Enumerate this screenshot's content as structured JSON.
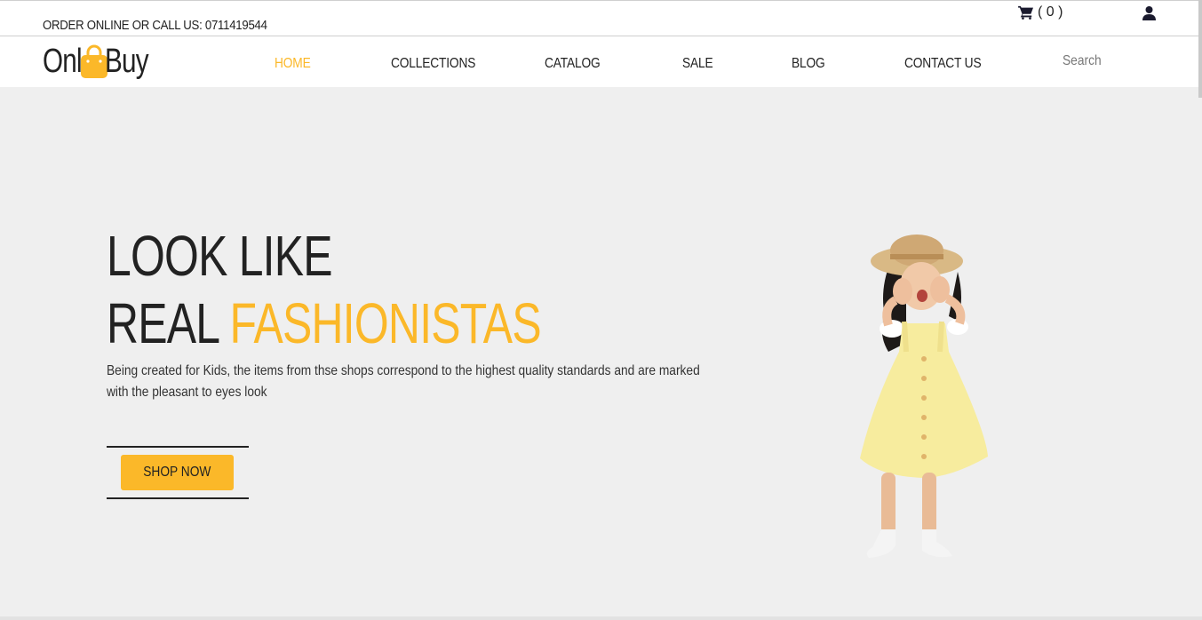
{
  "topbar": {
    "order_text": "ORDER ONLINE OR CALL US: 0711419544",
    "cart_count": "( 0 )",
    "cart_icon": "cart-icon",
    "user_icon": "user-icon"
  },
  "brand": {
    "logo_left": "Onl",
    "logo_right": "Buy",
    "logo_icon": "shopping-bag-icon"
  },
  "nav": {
    "items": [
      "HOME",
      "COLLECTIONS",
      "CATALOG",
      "SALE",
      "BLOG",
      "CONTACT US"
    ],
    "active": "HOME",
    "search_placeholder": "Search"
  },
  "hero": {
    "line1": "LOOK LIKE",
    "line2_plain": "REAL ",
    "line2_accent": "FASHIONISTAS",
    "description": "Being created for Kids, the items from thse shops correspond to the highest quality standards and are marked with the pleasant to eyes look",
    "button_label": "SHOP NOW"
  },
  "colors": {
    "accent": "#fbb829",
    "hero_background": "#efefef",
    "text": "#222222"
  }
}
